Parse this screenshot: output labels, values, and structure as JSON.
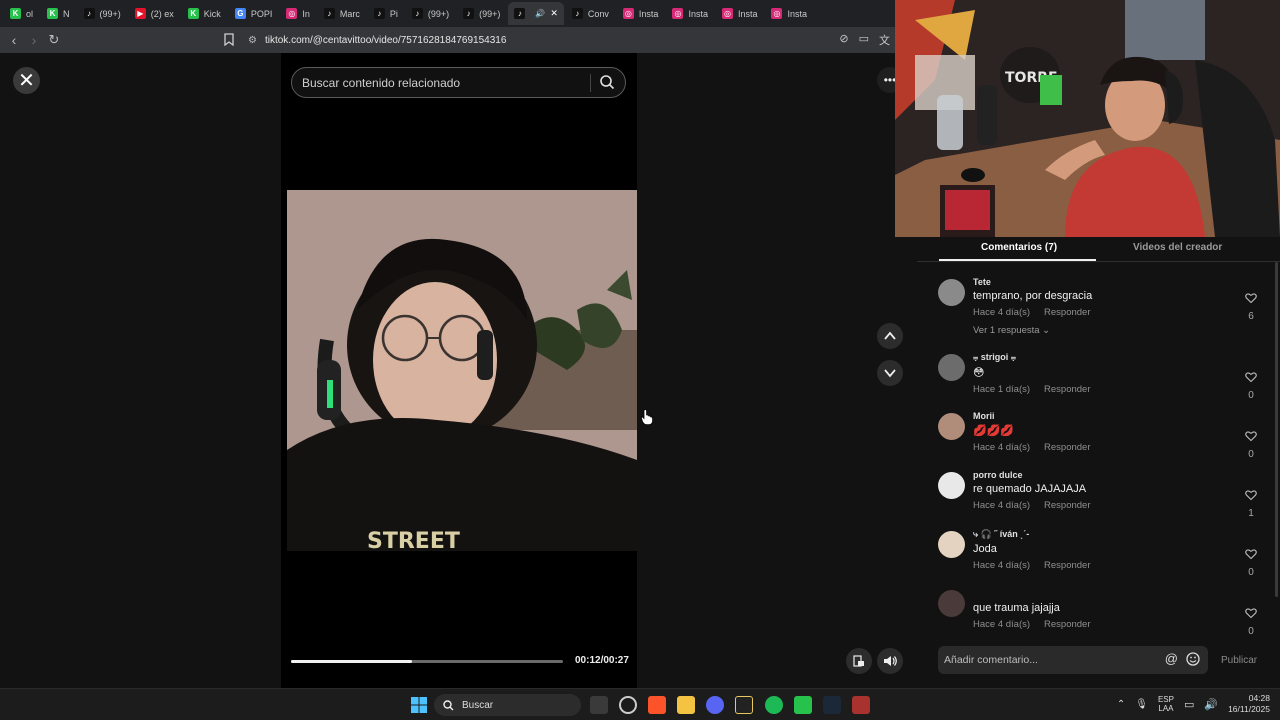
{
  "browser": {
    "tabs": [
      {
        "label": "ol",
        "favicon_color": "#27c24c",
        "favicon_glyph": "K"
      },
      {
        "label": "N",
        "favicon_color": "#27c24c",
        "favicon_glyph": "K"
      },
      {
        "label": "(99+)",
        "favicon_color": "#111111",
        "favicon_glyph": "♪"
      },
      {
        "label": "(2) ex",
        "favicon_color": "#e4122a",
        "favicon_glyph": "▶"
      },
      {
        "label": "Kick",
        "favicon_color": "#27c24c",
        "favicon_glyph": "K"
      },
      {
        "label": "POPI",
        "favicon_color": "#4285f4",
        "favicon_glyph": "G"
      },
      {
        "label": "In",
        "favicon_color": "#d62976",
        "favicon_glyph": "◎"
      },
      {
        "label": "Marc",
        "favicon_color": "#111111",
        "favicon_glyph": "♪"
      },
      {
        "label": "Pi",
        "favicon_color": "#111111",
        "favicon_glyph": "♪"
      },
      {
        "label": "(99+)",
        "favicon_color": "#111111",
        "favicon_glyph": "♪"
      },
      {
        "label": "(99+)",
        "favicon_color": "#111111",
        "favicon_glyph": "♪"
      },
      {
        "label": "",
        "favicon_color": "#111111",
        "favicon_glyph": "♪",
        "active": true
      },
      {
        "label": "Conv",
        "favicon_color": "#111111",
        "favicon_glyph": "♪"
      },
      {
        "label": "Insta",
        "favicon_color": "#d62976",
        "favicon_glyph": "◎"
      },
      {
        "label": "Insta",
        "favicon_color": "#d62976",
        "favicon_glyph": "◎"
      },
      {
        "label": "Insta",
        "favicon_color": "#d62976",
        "favicon_glyph": "◎"
      },
      {
        "label": "Insta",
        "favicon_color": "#d62976",
        "favicon_glyph": "◎"
      }
    ],
    "url": "tiktok.com/@centavittoo/video/7571628184769154316"
  },
  "viewer": {
    "search_placeholder": "Buscar contenido relacionado",
    "progress": 0.4444,
    "time": "00:12/00:27"
  },
  "comments_panel": {
    "tab_comments": "Comentarios (7)",
    "tab_creator_videos": "Videos del creador",
    "reply_label": "Responder",
    "comments": [
      {
        "user": "Tete",
        "text": "temprano, por desgracia",
        "time": "Hace 4 día(s)",
        "likes": "6",
        "replies": "Ver 1 respuesta",
        "avatar_color": "#8a8a8a"
      },
      {
        "user": "⩦ strigoi ⩦",
        "text": "😳",
        "time": "Hace 1 día(s)",
        "likes": "0",
        "avatar_color": "#6c6c6c"
      },
      {
        "user": "Morii",
        "text": "💋💋💋",
        "time": "Hace 4 día(s)",
        "likes": "0",
        "avatar_color": "#b08c7a"
      },
      {
        "user": "porro dulce",
        "text": "re quemado JAJAJAJA",
        "time": "Hace 4 día(s)",
        "likes": "1",
        "avatar_color": "#e8e8e8"
      },
      {
        "user": "⤷ 🎧 ˝ íván ˎˊ-",
        "text": "Joda",
        "time": "Hace 4 día(s)",
        "likes": "0",
        "avatar_color": "#e3d3c0"
      },
      {
        "user": "",
        "text": "que trauma jajajja",
        "time": "Hace 4 día(s)",
        "likes": "0",
        "avatar_color": "#4a3a3a"
      }
    ],
    "composer_placeholder": "Añadir comentario...",
    "publish_label": "Publicar"
  },
  "taskbar": {
    "search_label": "Buscar",
    "language": "ESP",
    "language_sub": "LAA",
    "time": "04:28",
    "date": "16/11/2025"
  }
}
